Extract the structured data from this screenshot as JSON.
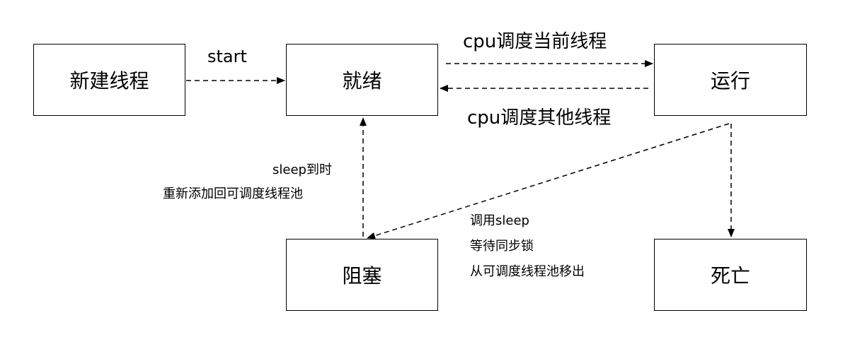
{
  "states": {
    "new": "新建线程",
    "ready": "就绪",
    "running": "运行",
    "blocked": "阻塞",
    "dead": "死亡"
  },
  "transitions": {
    "start": "start",
    "cpu_schedule_current": "cpu调度当前线程",
    "cpu_schedule_other": "cpu调度其他线程",
    "sleep_timeout": [
      "sleep到时",
      "重新添加回可调度线程池"
    ],
    "block_reasons": [
      "调用sleep",
      "等待同步锁",
      "从可调度线程池移出"
    ]
  },
  "colors": {
    "line": "#000000",
    "background": "#ffffff"
  }
}
